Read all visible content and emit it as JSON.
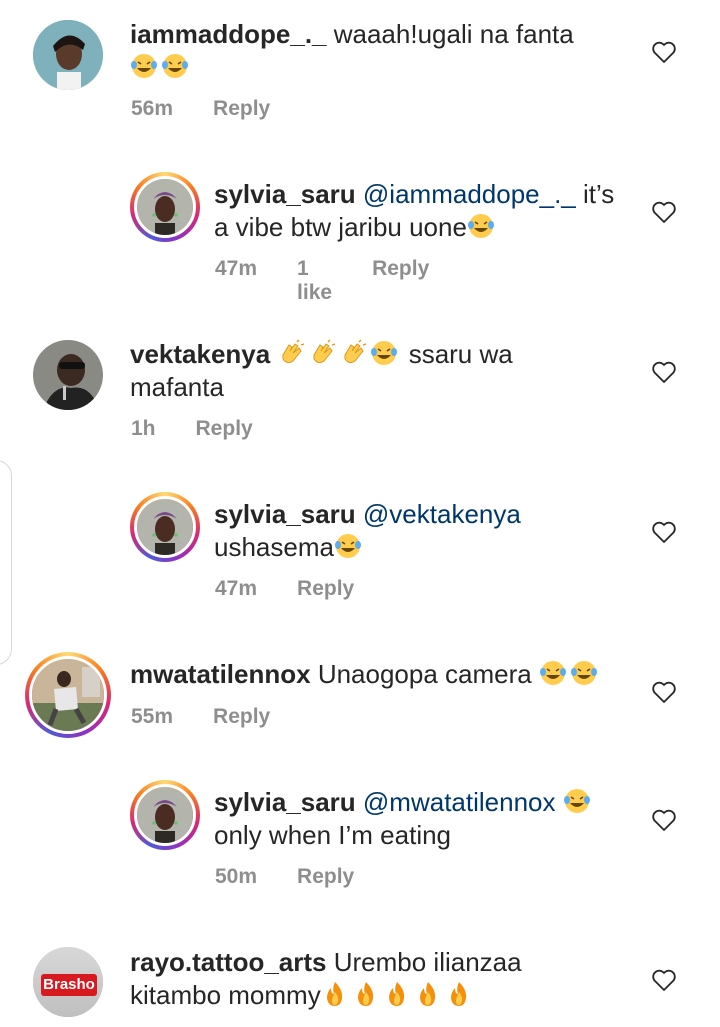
{
  "comments": [
    {
      "username": "iammaddope_._",
      "body": " waaah!ugali na fanta",
      "emoji_tail": [
        "laugh",
        "laugh"
      ],
      "time": "56m",
      "reply_label": "Reply"
    },
    {
      "username": "sylvia_saru",
      "mention": "@iammaddope_._",
      "body_line1": " it’s",
      "body_line2": "a vibe btw jaribu uone",
      "emoji_tail": [
        "laugh"
      ],
      "time": "47m",
      "likes": "1 like",
      "reply_label": "Reply"
    },
    {
      "username": "vektakenya",
      "body_after_emoji": " ssaru wa",
      "body_line2": "mafanta",
      "time": "1h",
      "reply_label": "Reply"
    },
    {
      "username": "sylvia_saru",
      "mention": "@vektakenya",
      "body_line2": "ushasema",
      "time": "47m",
      "reply_label": "Reply"
    },
    {
      "username": "mwatatilennox",
      "body": " Unaogopa camera ",
      "time": "55m",
      "reply_label": "Reply"
    },
    {
      "username": "sylvia_saru",
      "mention": "@mwatatilennox",
      "body_line2": "only when I’m eating",
      "time": "50m",
      "reply_label": "Reply"
    },
    {
      "username": "rayo.tattoo_arts",
      "body": " Urembo ilianzaa",
      "body_line2": "kitambo mommy",
      "avatar_badge": "Brasho"
    }
  ],
  "colors": {
    "text": "#262626",
    "meta": "#8e8e8e",
    "mention": "#00376b"
  },
  "icons": [
    "heart-outline-icon",
    "laugh-cry-emoji",
    "clap-emoji",
    "fire-emoji"
  ]
}
